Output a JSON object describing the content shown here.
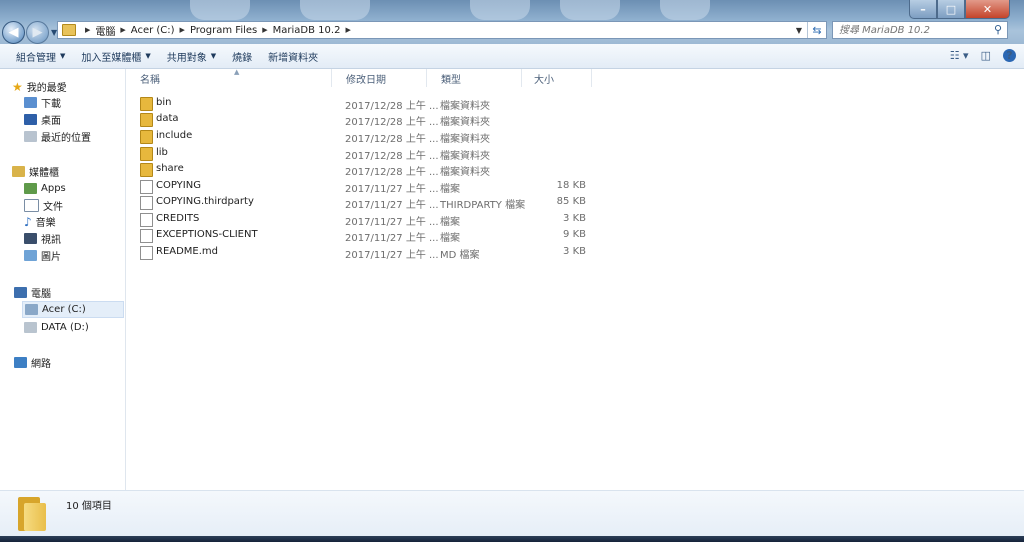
{
  "address": {
    "breadcrumbs": [
      "電腦",
      "Acer (C:)",
      "Program Files",
      "MariaDB 10.2"
    ]
  },
  "search": {
    "placeholder": "搜尋 MariaDB 10.2"
  },
  "toolbar": {
    "organize": "組合管理",
    "add_to_library": "加入至媒體櫃",
    "share_with": "共用對象",
    "burn": "燒錄",
    "new_folder": "新增資料夾"
  },
  "sidebar": {
    "favorites": {
      "label": "我的最愛",
      "items": [
        "下載",
        "桌面",
        "最近的位置"
      ]
    },
    "libraries": {
      "label": "媒體櫃",
      "items": [
        "Apps",
        "文件",
        "音樂",
        "視訊",
        "圖片"
      ]
    },
    "computer": {
      "label": "電腦",
      "items": [
        "Acer (C:)",
        "DATA (D:)"
      ]
    },
    "network": {
      "label": "網路"
    }
  },
  "columns": [
    "名稱",
    "修改日期",
    "類型",
    "大小"
  ],
  "files": [
    {
      "name": "bin",
      "date": "2017/12/28 上午 ...",
      "type": "檔案資料夾",
      "size": "",
      "kind": "folder"
    },
    {
      "name": "data",
      "date": "2017/12/28 上午 ...",
      "type": "檔案資料夾",
      "size": "",
      "kind": "folder"
    },
    {
      "name": "include",
      "date": "2017/12/28 上午 ...",
      "type": "檔案資料夾",
      "size": "",
      "kind": "folder"
    },
    {
      "name": "lib",
      "date": "2017/12/28 上午 ...",
      "type": "檔案資料夾",
      "size": "",
      "kind": "folder"
    },
    {
      "name": "share",
      "date": "2017/12/28 上午 ...",
      "type": "檔案資料夾",
      "size": "",
      "kind": "folder"
    },
    {
      "name": "COPYING",
      "date": "2017/11/27 上午 ...",
      "type": "檔案",
      "size": "18 KB",
      "kind": "file"
    },
    {
      "name": "COPYING.thirdparty",
      "date": "2017/11/27 上午 ...",
      "type": "THIRDPARTY 檔案",
      "size": "85 KB",
      "kind": "file"
    },
    {
      "name": "CREDITS",
      "date": "2017/11/27 上午 ...",
      "type": "檔案",
      "size": "3 KB",
      "kind": "file"
    },
    {
      "name": "EXCEPTIONS-CLIENT",
      "date": "2017/11/27 上午 ...",
      "type": "檔案",
      "size": "9 KB",
      "kind": "file"
    },
    {
      "name": "README.md",
      "date": "2017/11/27 上午 ...",
      "type": "MD 檔案",
      "size": "3 KB",
      "kind": "file"
    }
  ],
  "status": {
    "item_count": "10 個項目"
  }
}
